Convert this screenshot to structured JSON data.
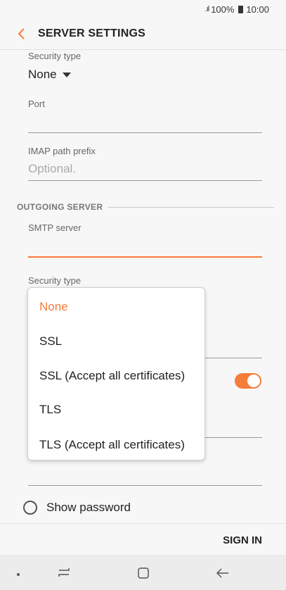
{
  "status": {
    "battery": "100%",
    "time": "10:00"
  },
  "header": {
    "title": "SERVER SETTINGS"
  },
  "incoming": {
    "security_label": "Security type",
    "security_value": "None",
    "port_label": "Port",
    "port_value": "",
    "path_label": "IMAP path prefix",
    "path_placeholder": "Optional."
  },
  "outgoing": {
    "section_label": "OUTGOING SERVER",
    "smtp_label": "SMTP server",
    "smtp_value": "",
    "security_label": "Security type",
    "toggle_on": true
  },
  "dropdown": {
    "options": [
      {
        "label": "None",
        "selected": true
      },
      {
        "label": "SSL",
        "selected": false
      },
      {
        "label": "SSL (Accept all certificates)",
        "selected": false
      },
      {
        "label": "TLS",
        "selected": false
      },
      {
        "label": "TLS (Accept all certificates)",
        "selected": false
      }
    ]
  },
  "show_password": {
    "label": "Show password",
    "checked": false
  },
  "actions": {
    "sign_in": "SIGN IN"
  },
  "colors": {
    "accent": "#f57c3a",
    "text": "#222222"
  },
  "icons": {
    "back": "chevron-left-icon",
    "caret": "caret-down-icon",
    "recent": "recent-apps-icon",
    "home": "home-icon",
    "nav_back": "back-arrow-icon"
  }
}
